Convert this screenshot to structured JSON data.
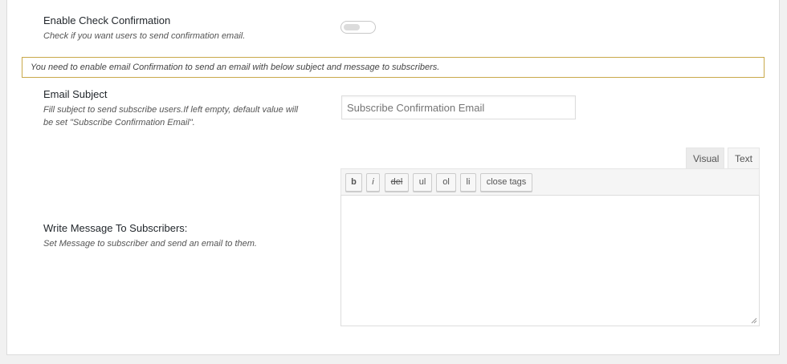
{
  "check_confirmation": {
    "label": "Enable Check Confirmation",
    "description": "Check if you want users to send confirmation email.",
    "toggle_on": false
  },
  "notice": {
    "text": "You need to enable email Confirmation to send an email with below subject and message to subscribers."
  },
  "email_subject": {
    "label": "Email Subject",
    "description_line1": "Fill subject to send subscribe users.If left empty, default value will",
    "description_line2": "be set \"Subscribe Confirmation Email\".",
    "placeholder": "Subscribe Confirmation Email"
  },
  "message": {
    "label": "Write Message To Subscribers:",
    "description": "Set Message to subscriber and send an email to them.",
    "tabs": {
      "visual": "Visual",
      "text": "Text"
    },
    "toolbar": {
      "b": "b",
      "i": "i",
      "del": "del",
      "ul": "ul",
      "ol": "ol",
      "li": "li",
      "close_tags": "close tags"
    },
    "value": ""
  }
}
